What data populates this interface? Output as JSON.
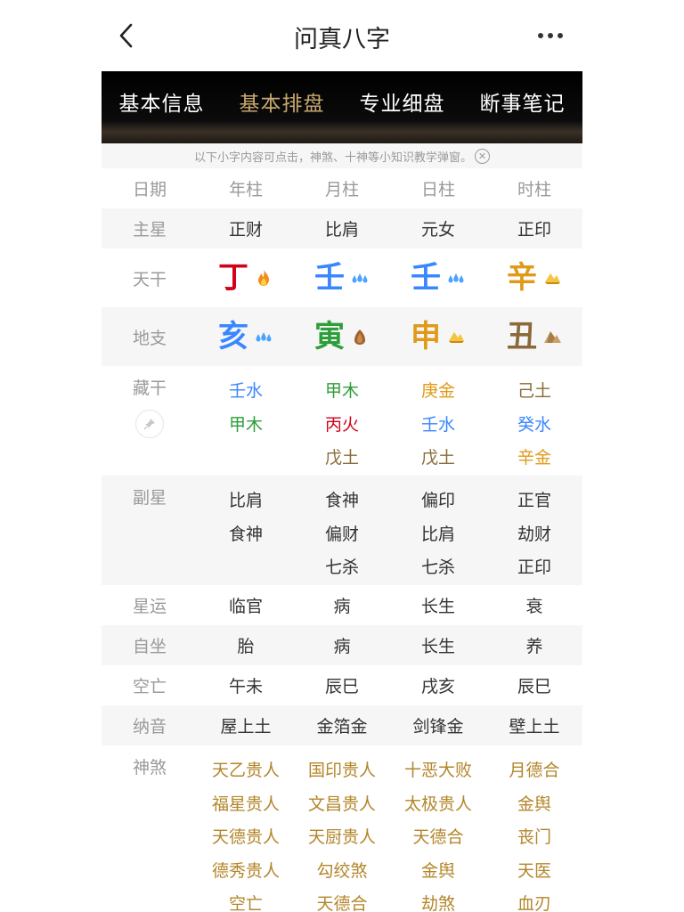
{
  "header": {
    "title": "问真八字"
  },
  "tabs": [
    {
      "label": "基本信息",
      "active": false
    },
    {
      "label": "基本排盘",
      "active": true
    },
    {
      "label": "专业细盘",
      "active": false
    },
    {
      "label": "断事笔记",
      "active": false
    }
  ],
  "notice": {
    "text": "以下小字内容可点击，神煞、十神等小知识教学弹窗。",
    "close_icon": "circle-x"
  },
  "colors": {
    "tab_active": "#c9a86e",
    "fire": "#d0021b",
    "water": "#3a86ff",
    "wood": "#2e9e3a",
    "metal": "#e09a1a",
    "earth": "#8a6a3a",
    "shensha": "#b3862a"
  },
  "chart": {
    "labels": {
      "date": "日期",
      "main_star": "主星",
      "tiangan": "天干",
      "dizhi": "地支",
      "canggan": "藏干",
      "fuxing": "副星",
      "xingyun": "星运",
      "zizuo": "自坐",
      "kongwang": "空亡",
      "nayin": "纳音",
      "shensha": "神煞"
    },
    "columns": [
      "年柱",
      "月柱",
      "日柱",
      "时柱"
    ],
    "main_star": [
      "正财",
      "比肩",
      "元女",
      "正印"
    ],
    "tiangan": [
      {
        "char": "丁",
        "element": "fire",
        "icon": "fire-icon"
      },
      {
        "char": "壬",
        "element": "water",
        "icon": "water-drops-icon"
      },
      {
        "char": "壬",
        "element": "water",
        "icon": "water-drops-icon"
      },
      {
        "char": "辛",
        "element": "metal",
        "icon": "gold-ingot-icon"
      }
    ],
    "dizhi": [
      {
        "char": "亥",
        "element": "water",
        "icon": "water-drops-icon"
      },
      {
        "char": "寅",
        "element": "wood",
        "icon": "wood-icon"
      },
      {
        "char": "申",
        "element": "metal",
        "icon": "gold-ingot-icon"
      },
      {
        "char": "丑",
        "element": "earth",
        "icon": "earth-mound-icon"
      }
    ],
    "canggan": [
      [
        {
          "text": "壬水",
          "element": "water"
        },
        {
          "text": "甲木",
          "element": "wood"
        }
      ],
      [
        {
          "text": "甲木",
          "element": "wood"
        },
        {
          "text": "丙火",
          "element": "fire"
        },
        {
          "text": "戊土",
          "element": "earth"
        }
      ],
      [
        {
          "text": "庚金",
          "element": "metal"
        },
        {
          "text": "壬水",
          "element": "water"
        },
        {
          "text": "戊土",
          "element": "earth"
        }
      ],
      [
        {
          "text": "己土",
          "element": "earth"
        },
        {
          "text": "癸水",
          "element": "water"
        },
        {
          "text": "辛金",
          "element": "metal"
        }
      ]
    ],
    "fuxing": [
      [
        "比肩",
        "食神"
      ],
      [
        "食神",
        "偏财",
        "七杀"
      ],
      [
        "偏印",
        "比肩",
        "七杀"
      ],
      [
        "正官",
        "劫财",
        "正印"
      ]
    ],
    "xingyun": [
      "临官",
      "病",
      "长生",
      "衰"
    ],
    "zizuo": [
      "胎",
      "病",
      "长生",
      "养"
    ],
    "kongwang": [
      "午未",
      "辰巳",
      "戌亥",
      "辰巳"
    ],
    "nayin": [
      "屋上土",
      "金箔金",
      "剑锋金",
      "壁上土"
    ],
    "shensha": [
      [
        "天乙贵人",
        "福星贵人",
        "天德贵人",
        "德秀贵人",
        "空亡"
      ],
      [
        "国印贵人",
        "文昌贵人",
        "天厨贵人",
        "勾绞煞",
        "天德合"
      ],
      [
        "十恶大败",
        "太极贵人",
        "天德合",
        "金舆",
        "劫煞"
      ],
      [
        "月德合",
        "金舆",
        "丧门",
        "天医",
        "血刃"
      ]
    ]
  }
}
